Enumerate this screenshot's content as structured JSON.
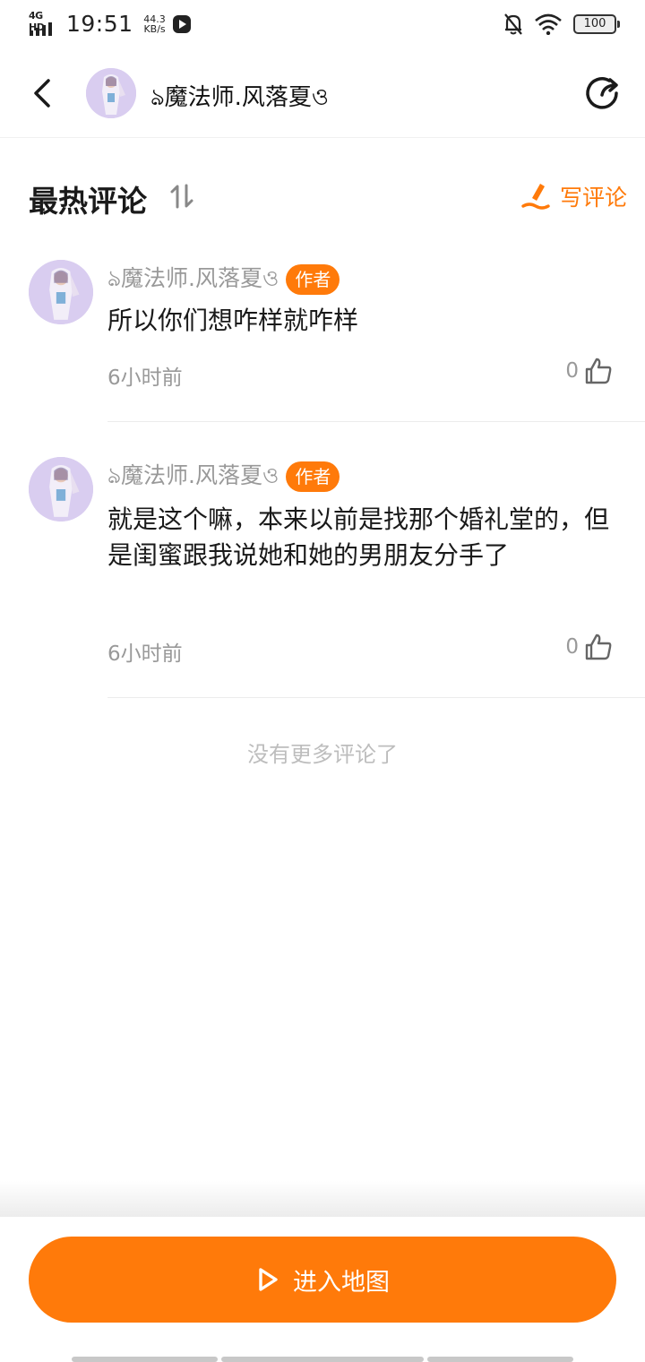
{
  "status_bar": {
    "network": "4G HD",
    "time": "19:51",
    "speed_value": "44.3",
    "speed_unit": "KB/s",
    "battery": "100"
  },
  "header": {
    "title": "ঌ魔法师.风落夏ও"
  },
  "section": {
    "title": "最热评论",
    "write_label": "写评论"
  },
  "comments": [
    {
      "author": "ঌ魔法师.风落夏ও",
      "badge": "作者",
      "text": "所以你们想咋样就咋样",
      "time": "6小时前",
      "likes": "0"
    },
    {
      "author": "ঌ魔法师.风落夏ও",
      "badge": "作者",
      "text": "就是这个嘛，本来以前是找那个婚礼堂的，但是闺蜜跟我说她和她的男朋友分手了",
      "time": "6小时前",
      "likes": "0"
    }
  ],
  "no_more": "没有更多评论了",
  "bottom": {
    "enter_map_label": "进入地图"
  },
  "colors": {
    "accent": "#ff7a0a",
    "muted_text": "#999999",
    "avatar_bg": "#d9cdf0"
  },
  "icons": [
    "back-arrow-icon",
    "share-icon",
    "sort-icon",
    "pen-icon",
    "like-icon",
    "play-icon",
    "silent-bell-icon",
    "wifi-icon",
    "battery-icon",
    "screen-record-icon"
  ]
}
